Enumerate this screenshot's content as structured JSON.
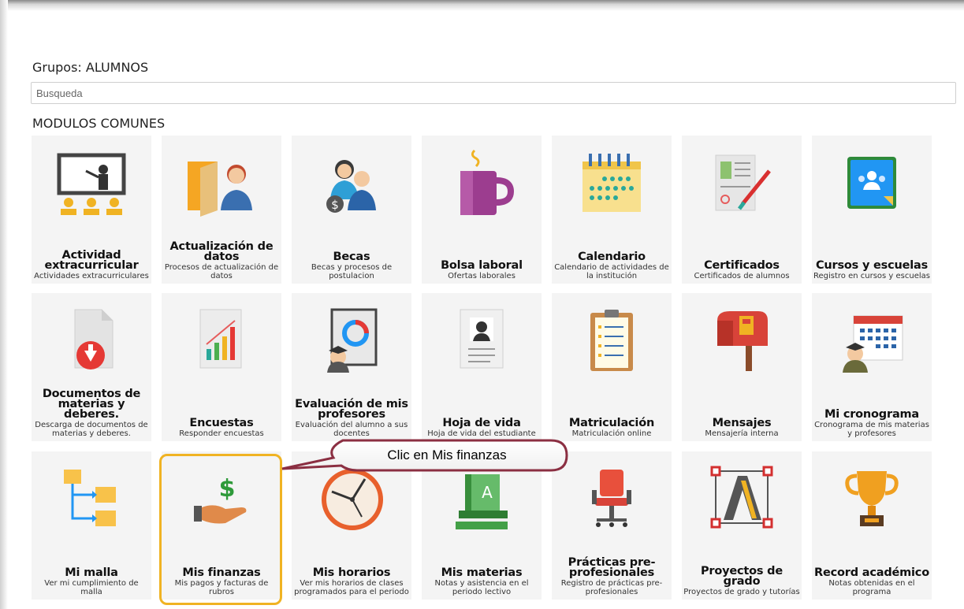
{
  "header": {
    "group_title": "Grupos: ALUMNOS",
    "search_placeholder": "Busqueda",
    "section_title": "MODULOS COMUNES"
  },
  "callout": {
    "text": "Clic en Mis finanzas"
  },
  "colors": {
    "tile_bg": "#f4f4f4",
    "highlight_border": "#f0b323",
    "callout_border": "#8b2f42"
  },
  "tiles": [
    {
      "title": "Actividad extracurricular",
      "desc": "Actividades extracurriculares",
      "icon": "classroom-teacher-icon"
    },
    {
      "title": "Actualización de datos",
      "desc": "Procesos de actualización de datos",
      "icon": "folder-user-icon"
    },
    {
      "title": "Becas",
      "desc": "Becas y procesos de postulacion",
      "icon": "scholarship-people-icon"
    },
    {
      "title": "Bolsa laboral",
      "desc": "Ofertas laborales",
      "icon": "coffee-mug-icon"
    },
    {
      "title": "Calendario",
      "desc": "Calendario de actividades de la institución",
      "icon": "calendar-icon"
    },
    {
      "title": "Certificados",
      "desc": "Certificados de alumnos",
      "icon": "certificate-pen-icon"
    },
    {
      "title": "Cursos y escuelas",
      "desc": "Registro en cursos y escuelas",
      "icon": "classroom-group-icon"
    },
    {
      "title": "Documentos de materias y deberes.",
      "desc": "Descarga de documentos de materias y deberes.",
      "icon": "document-download-icon"
    },
    {
      "title": "Encuestas",
      "desc": "Responder encuestas",
      "icon": "survey-chart-icon"
    },
    {
      "title": "Evaluación de mis profesores",
      "desc": "Evaluación del alumno a sus docentes",
      "icon": "teacher-evaluation-icon"
    },
    {
      "title": "Hoja de vida",
      "desc": "Hoja de vida del estudiante",
      "icon": "resume-icon"
    },
    {
      "title": "Matriculación",
      "desc": "Matriculación online",
      "icon": "clipboard-list-icon"
    },
    {
      "title": "Mensajes",
      "desc": "Mensajería interna",
      "icon": "mailbox-icon"
    },
    {
      "title": "Mi cronograma",
      "desc": "Cronograma de mis materias y profesores",
      "icon": "schedule-calendar-icon"
    },
    {
      "title": "Mi malla",
      "desc": "Ver mi cumplimiento de malla",
      "icon": "tree-structure-icon"
    },
    {
      "title": "Mis finanzas",
      "desc": "Mis pagos y facturas de rubros",
      "icon": "hand-money-icon"
    },
    {
      "title": "Mis horarios",
      "desc": "Ver mis horarios de clases programados para el periodo",
      "icon": "clock-icon"
    },
    {
      "title": "Mis materias",
      "desc": "Notas y asistencia en el periodo lectivo",
      "icon": "books-icon"
    },
    {
      "title": "Prácticas pre-profesionales",
      "desc": "Registro de prácticas pre-profesionales",
      "icon": "office-chair-icon"
    },
    {
      "title": "Proyectos de grado",
      "desc": "Proyectos de grado y tutorías",
      "icon": "design-letter-icon"
    },
    {
      "title": "Record académico",
      "desc": "Notas obtenidas en el programa",
      "icon": "trophy-icon"
    }
  ]
}
